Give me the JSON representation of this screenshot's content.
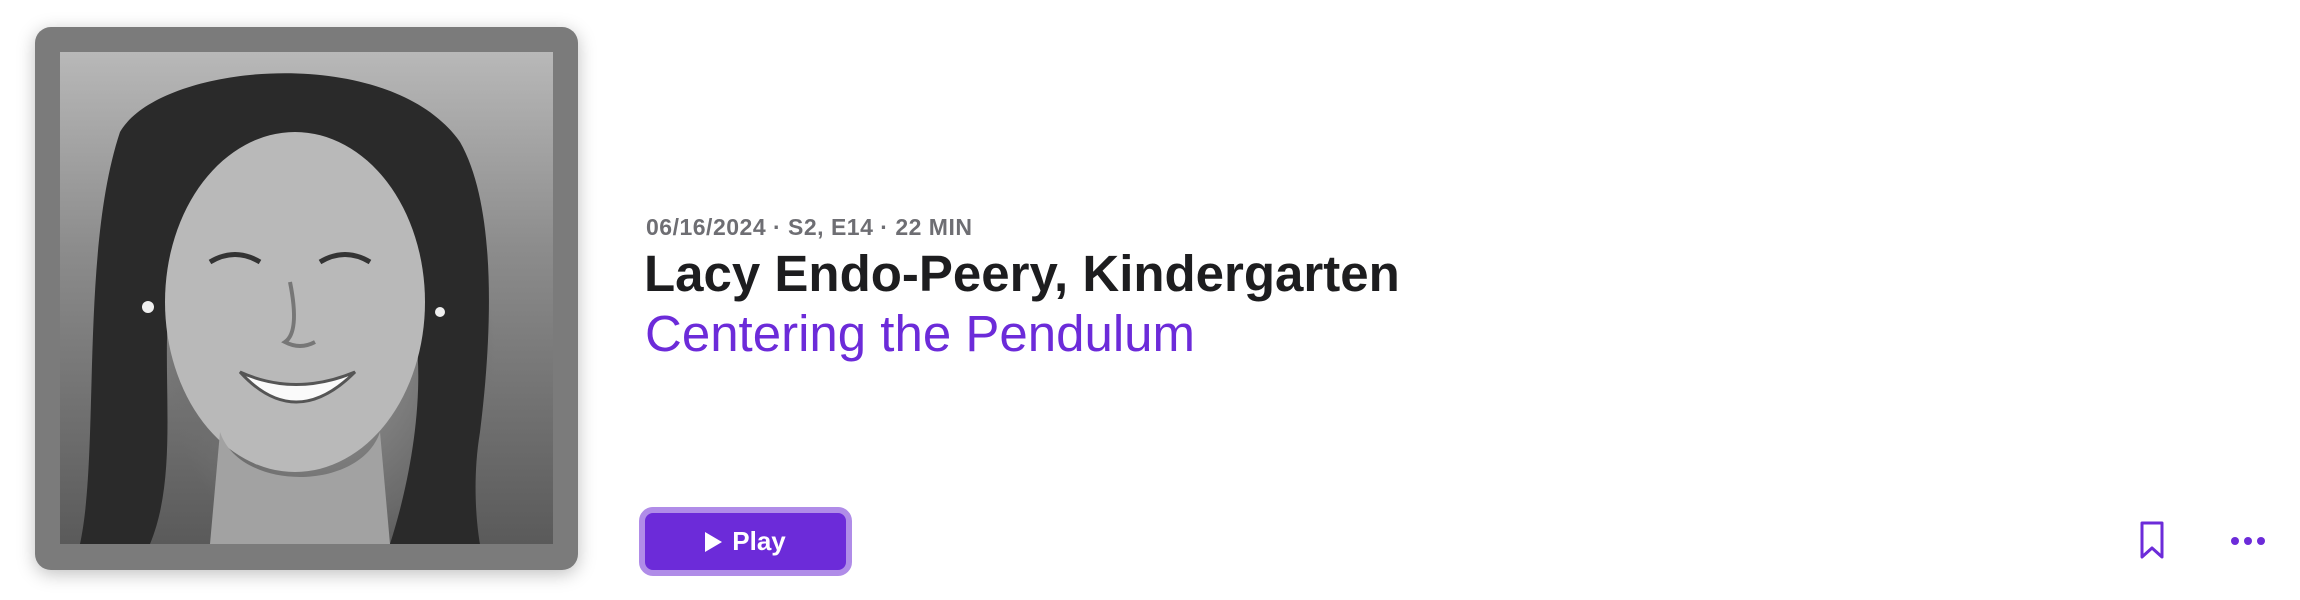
{
  "episode": {
    "meta": "06/16/2024 · S2, E14 · 22 MIN",
    "title": "Lacy Endo-Peery, Kindergarten",
    "subtitle": "Centering the Pendulum"
  },
  "actions": {
    "play_label": "Play",
    "play_icon": "play-icon",
    "bookmark_icon": "bookmark-icon",
    "more_icon": "more-icon"
  },
  "colors": {
    "accent": "#6c2bd9",
    "accent_border": "#b08ce8",
    "title": "#1d1d1f",
    "meta": "#6e6e73"
  }
}
